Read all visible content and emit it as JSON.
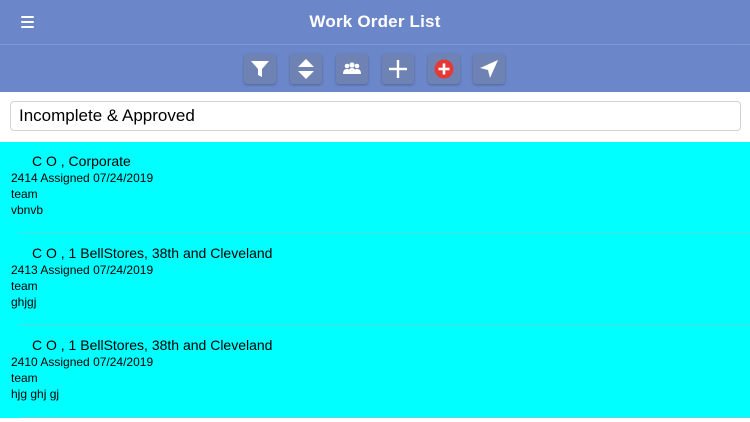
{
  "nav": {
    "title": "Work Order List",
    "bar_color": "#6b86c9"
  },
  "toolbar": {
    "buttons": [
      {
        "icon": "filter-icon"
      },
      {
        "icon": "sort-icon"
      },
      {
        "icon": "team-icon"
      },
      {
        "icon": "plus-icon"
      },
      {
        "icon": "add-circle-icon",
        "color": "#e53935"
      },
      {
        "icon": "location-arrow-icon"
      }
    ]
  },
  "filter": {
    "value": "Incomplete & Approved"
  },
  "list": {
    "row_color": "#00ffff",
    "items": [
      {
        "title": "C O , Corporate",
        "id_assigned": "2414 Assigned 07/24/2019",
        "group": "team",
        "note": "vbnvb"
      },
      {
        "title": "C O , 1 BellStores, 38th and Cleveland",
        "id_assigned": "2413 Assigned 07/24/2019",
        "group": "team",
        "note": "ghjgj"
      },
      {
        "title": "C O , 1 BellStores, 38th and Cleveland",
        "id_assigned": "2410 Assigned 07/24/2019",
        "group": "team",
        "note": "hjg ghj gj"
      }
    ]
  }
}
